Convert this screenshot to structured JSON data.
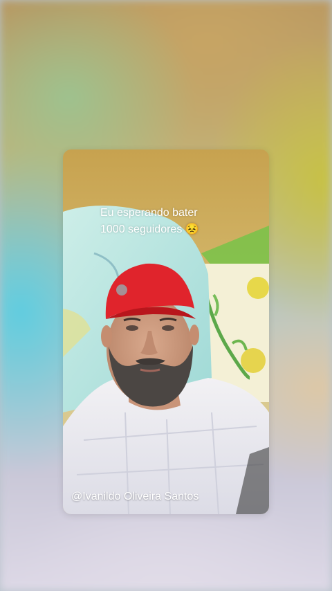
{
  "story": {
    "caption_line1": "Eu esperando  bater",
    "caption_line2": "1000 seguidores 😣",
    "author_credit": "@Ivanildo Oliveira Santos"
  },
  "colors": {
    "cap": "#e0242c",
    "pillow": "#bfe7e4",
    "shirt": "#eeeef2",
    "wall": "#c9a752"
  },
  "icons": [
    "video-frame",
    "profile-photo"
  ]
}
